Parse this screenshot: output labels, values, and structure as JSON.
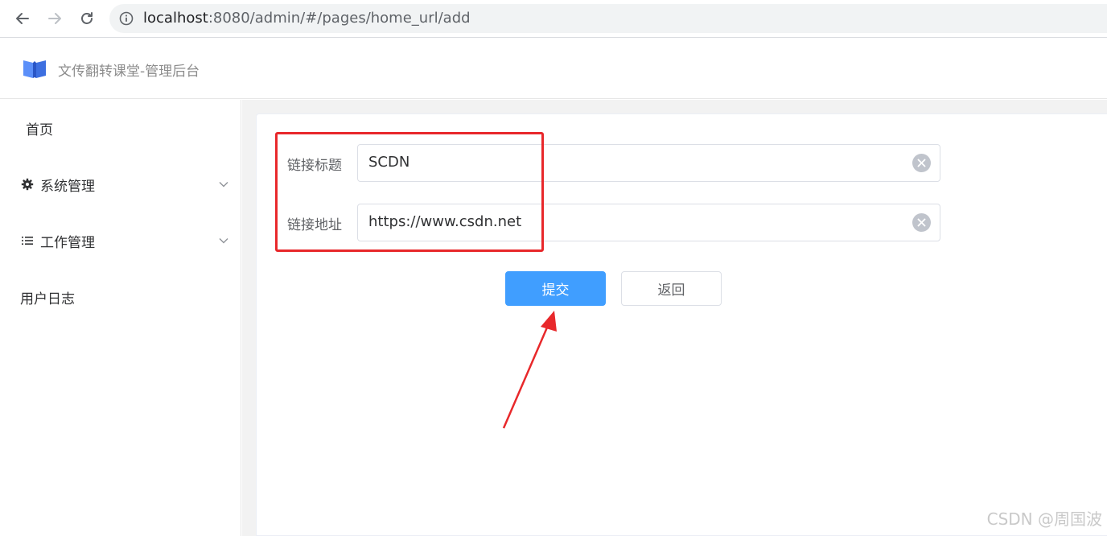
{
  "browser": {
    "url_host": "localhost",
    "url_rest": ":8080/admin/#/pages/home_url/add"
  },
  "header": {
    "title": "文传翻转课堂-管理后台"
  },
  "sidebar": {
    "items": [
      {
        "label": "首页",
        "icon": "",
        "expandable": false
      },
      {
        "label": "系统管理",
        "icon": "gear-icon",
        "expandable": true
      },
      {
        "label": "工作管理",
        "icon": "list-icon",
        "expandable": true
      },
      {
        "label": "用户日志",
        "icon": "",
        "expandable": false
      }
    ]
  },
  "form": {
    "fields": [
      {
        "label": "链接标题",
        "value": "SCDN"
      },
      {
        "label": "链接地址",
        "value": "https://www.csdn.net"
      }
    ],
    "submit_label": "提交",
    "back_label": "返回"
  },
  "watermark": "CSDN @周国波",
  "colors": {
    "primary": "#409eff",
    "annotation": "#e8282b"
  }
}
